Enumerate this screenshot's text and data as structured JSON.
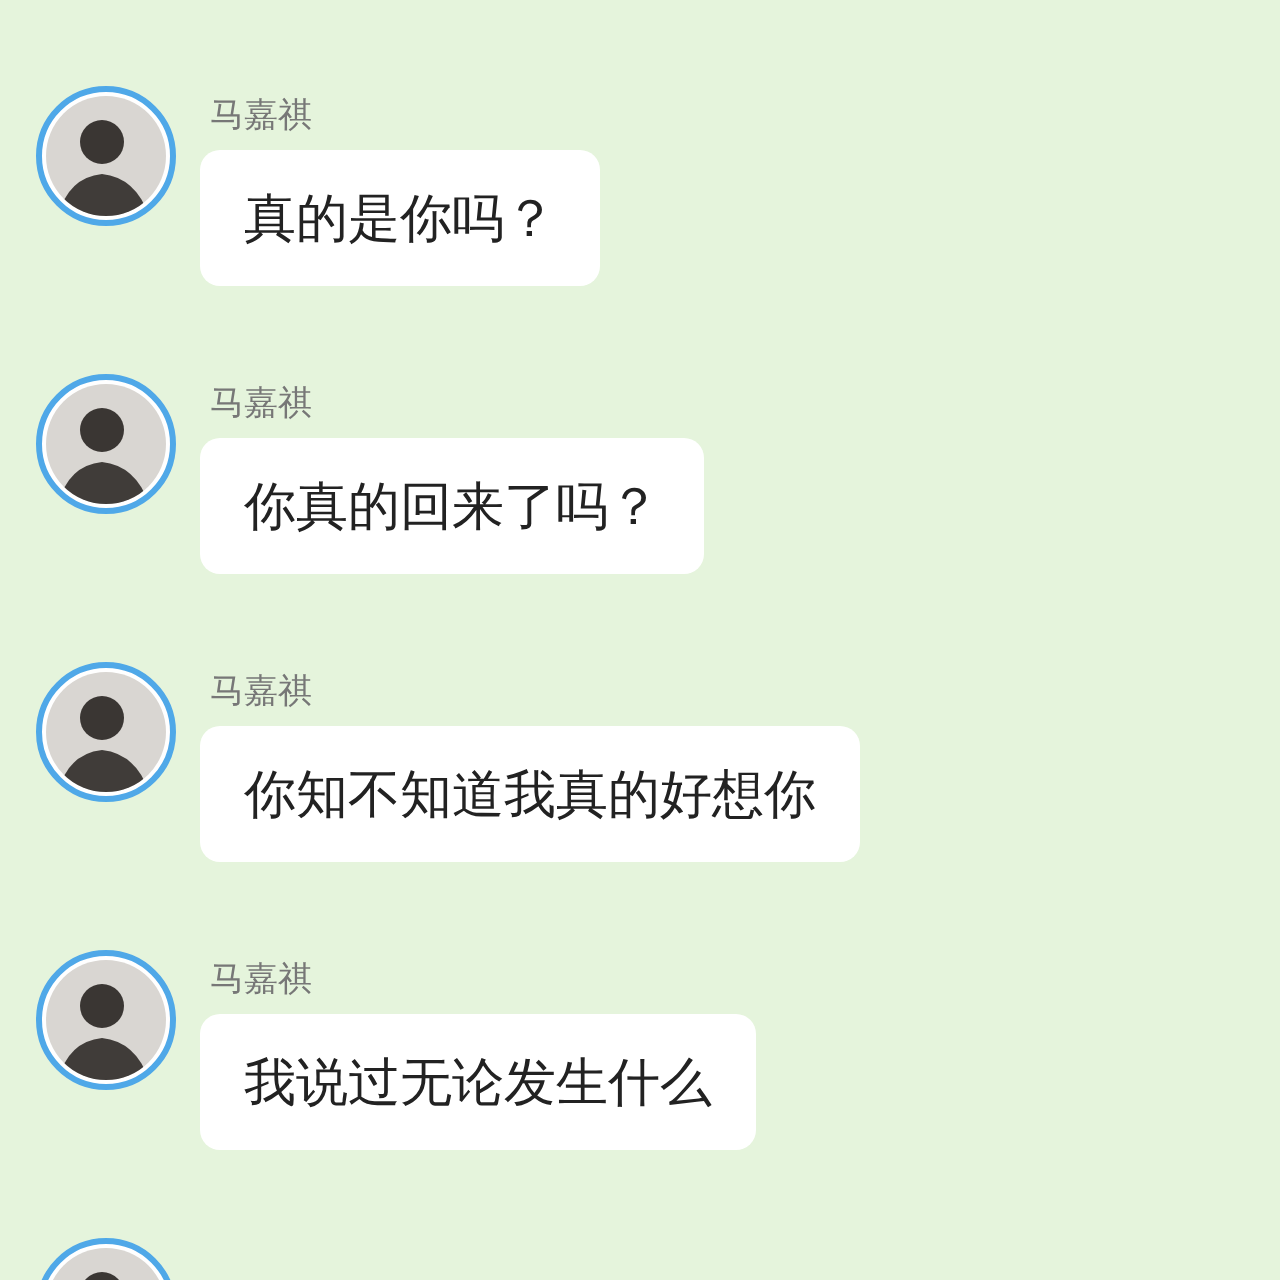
{
  "messages": [
    {
      "sender": "马嘉祺",
      "text": "真的是你吗？"
    },
    {
      "sender": "马嘉祺",
      "text": "你真的回来了吗？"
    },
    {
      "sender": "马嘉祺",
      "text": "你知不知道我真的好想你"
    },
    {
      "sender": "马嘉祺",
      "text": "我说过无论发生什么"
    }
  ]
}
